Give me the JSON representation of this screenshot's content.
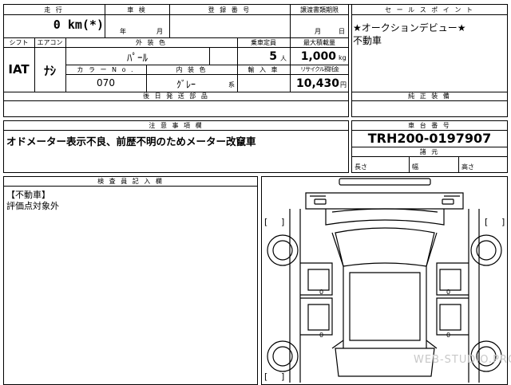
{
  "headers": {
    "mileage": "走 行",
    "shaken": "車 検",
    "registration": "登 録 番 号",
    "transfer_deadline": "譲渡書類期限",
    "sales_point": "セ ー ル ス ポ イ ン ト",
    "shift": "シフト",
    "aircon": "エアコン",
    "exterior_color": "外 装 色",
    "capacity": "乗車定員",
    "max_load": "最大積載量",
    "color_no": "カ ラ ー N o .",
    "interior_color": "内 装 色",
    "import_car": "輸 入 車",
    "recycle": "リサイクル預託金",
    "later_parts": "後 日 発 送 部 品",
    "genuine_equipment": "純 正 装 備",
    "caution": "注 意 事 項 欄",
    "chassis_no": "車 台 番 号",
    "specs": "諸 元",
    "inspector": "検 査 員 記 入 欄"
  },
  "values": {
    "mileage": "0 km(*)",
    "shaken_year": "年",
    "shaken_month": "月",
    "transfer_month": "月",
    "transfer_day": "日",
    "shift": "IAT",
    "aircon": "ﾅｼ",
    "exterior_color": "ﾊﾟｰﾙ",
    "capacity": "5",
    "capacity_unit": "人",
    "max_load": "1,000",
    "max_load_unit": "kg",
    "color_no": "070",
    "interior_color": "ｸﾞﾚｰ",
    "interior_suffix": "系",
    "recycle": "10,430",
    "recycle_unit": "円",
    "chassis_no": "TRH200-0197907",
    "length_label": "長さ",
    "width_label": "幅",
    "height_label": "高さ"
  },
  "sales_points": [
    "★オークションデビュー★",
    "不動車"
  ],
  "caution_text": "オドメーター表示不良、前歴不明のためメーター改竄車",
  "inspector_notes": [
    "【不動車】",
    "評価点対象外"
  ],
  "diagram": {
    "bracket_open": "[",
    "bracket_close": "]",
    "zero": "0"
  },
  "watermark": "WEB-STUDIO.PRO"
}
